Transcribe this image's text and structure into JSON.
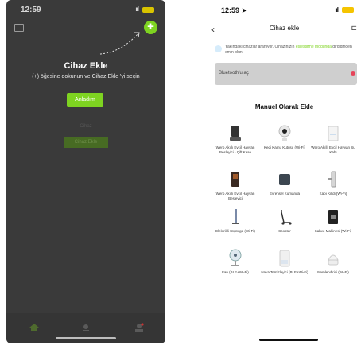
{
  "left": {
    "status_time": "12:59",
    "status_signal": "ııl",
    "overlay_title": "Cihaz Ekle",
    "overlay_desc": "(+) öğesine dokunun ve Cihaz Ekle 'yi seçin",
    "ok_label": "Anladım",
    "ghost_text": "Cihaz",
    "ghost_button": "Cihaz Ekle"
  },
  "right": {
    "status_time": "12:59 ➤",
    "status_signal": "ııl",
    "back_icon": "‹",
    "title": "Cihaz ekle",
    "scan_icon": "⊏",
    "info_text": "Yakındaki cihazlar aranıyor. Cihazınızın ",
    "info_link": "eşleştirme modunda",
    "info_text_end": " girdiğinden emin olun.",
    "bluetooth_label": "Bluetooth'u aç",
    "section_title": "Manuel Olarak Ekle",
    "devices": [
      {
        "label": "Wero Akıllı Evcil Hayvan Besleyici - Çift Kase",
        "icon": "feeder-bowl-icon"
      },
      {
        "label": "Kedi Kamu Kutusu (Wi-Fi)",
        "icon": "camera-icon"
      },
      {
        "label": "Wero Akıllı Evcil Hayvan Su Kabı",
        "icon": "water-dispenser-icon"
      },
      {
        "label": "Wero Akıllı Evcil Hayvan Besleyici",
        "icon": "feeder-icon"
      },
      {
        "label": "Evrensel Kumanda",
        "icon": "remote-icon"
      },
      {
        "label": "Kapı Kilidi (Wi-Fi)",
        "icon": "door-lock-icon"
      },
      {
        "label": "Elektrikli Süpürge (Wi-Fi)",
        "icon": "vacuum-icon"
      },
      {
        "label": "Scooter",
        "icon": "scooter-icon"
      },
      {
        "label": "Kahve Makinesi (Wi-Fi)",
        "icon": "coffee-machine-icon"
      },
      {
        "label": "Fan (BLE+Wi-Fi)",
        "icon": "fan-icon"
      },
      {
        "label": "Hava Temizleyici (BLE+Wi-Fi)",
        "icon": "air-purifier-icon"
      },
      {
        "label": "Nemlendirici (Wi-Fi)",
        "icon": "humidifier-icon"
      }
    ]
  },
  "colors": {
    "accent": "#7ed321",
    "overlay_bg": "#3a3a3a",
    "bluetooth_bar": "#cfcfcf",
    "alert_dot": "#e6445a"
  }
}
